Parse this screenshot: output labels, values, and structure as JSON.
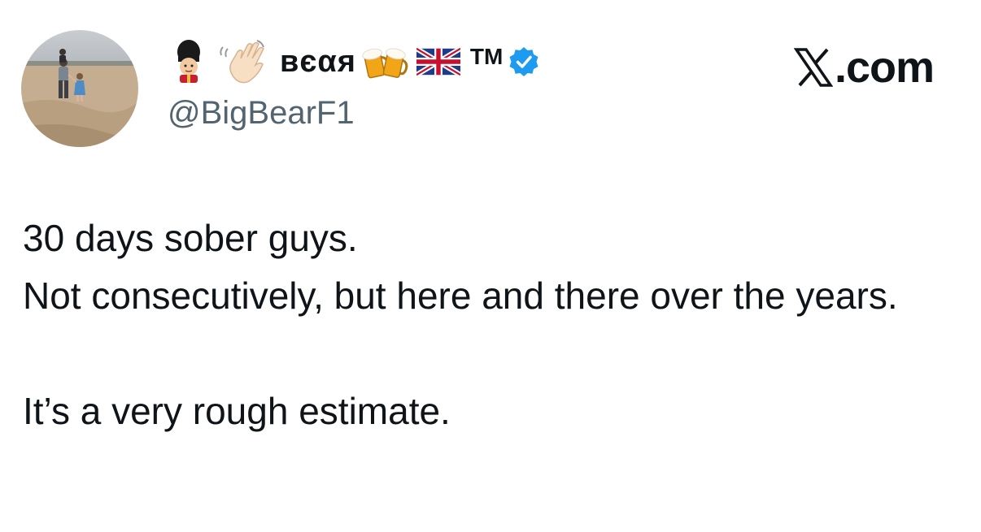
{
  "author": {
    "display_name": "ʙєαя",
    "trademark": "TM",
    "handle": "@BigBearF1",
    "verified": true,
    "badge_color": "#1d9bf0",
    "name_emojis_before": [
      "guard-icon",
      "waving-hand-icon"
    ],
    "name_emojis_after": [
      "beer-mugs-icon",
      "uk-flag-icon"
    ],
    "avatar": "avatar-photo"
  },
  "brand": {
    "text": ".com",
    "icon": "x-logo-icon"
  },
  "tweet": {
    "line1": "30 days sober guys.",
    "line2": "Not consecutively, but here and there over the years.",
    "line3": "It’s a very rough estimate."
  }
}
